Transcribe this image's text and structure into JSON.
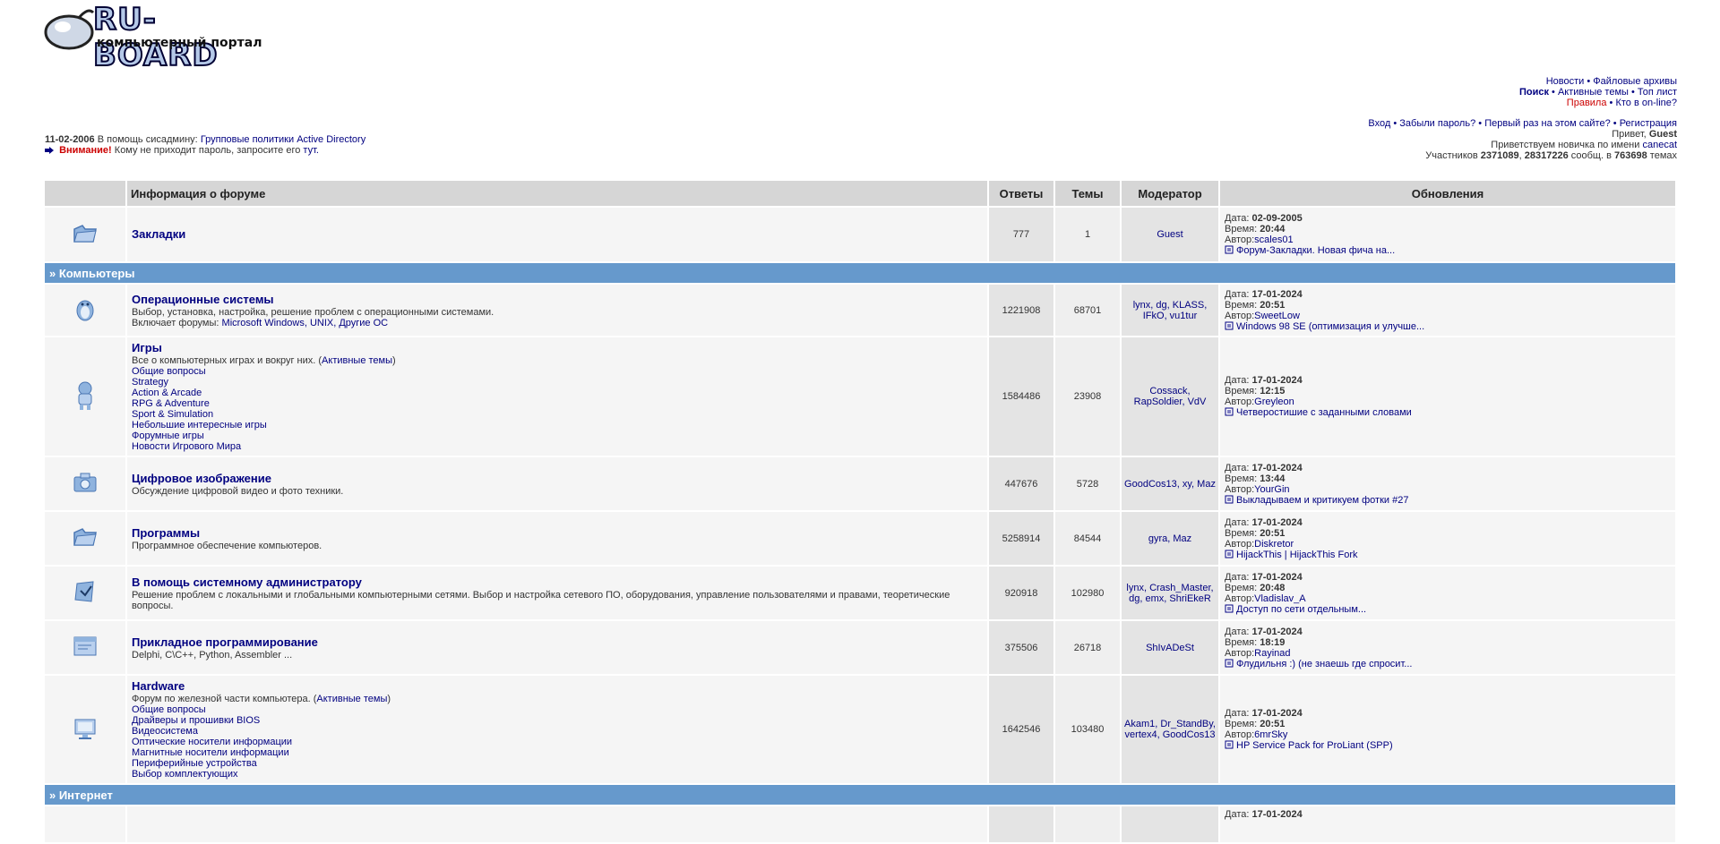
{
  "logo": {
    "name": "RU-BOARD",
    "subtitle": "компьютерный портал"
  },
  "nav": {
    "news": "Новости",
    "archives": "Файловые архивы",
    "search": "Поиск",
    "active": "Активные темы",
    "top": "Топ лист",
    "rules": "Правила",
    "online": "Кто в on-line?"
  },
  "auth": {
    "login": "Вход",
    "forgot": "Забыли пароль?",
    "first": "Первый раз на этом сайте?",
    "register": "Регистрация",
    "hello": "Привет,",
    "user": "Guest",
    "welcome": "Приветствуем новичка по имени",
    "newbie": "canecat",
    "stats_prefix": "Участников",
    "members": "2371089",
    "posts": "28317226",
    "posts_suffix": "сообщ. в",
    "topics": "763698",
    "topics_suffix": "темах"
  },
  "info": {
    "date": "11-02-2006",
    "help_prefix": "В помощь сисадмину:",
    "help_link": "Групповые политики Active Directory",
    "warn": "Внимание!",
    "warn_text": "Кому не приходит пароль, запросите его",
    "warn_link": "тут."
  },
  "table": {
    "headers": {
      "info": "Информация о форуме",
      "replies": "Ответы",
      "topics": "Темы",
      "moderator": "Модератор",
      "updates": "Обновления"
    },
    "labels": {
      "date": "Дата:",
      "time": "Время:",
      "author": "Автор:"
    },
    "bookmarks": {
      "title": "Закладки",
      "replies": "777",
      "topics": "1",
      "moderator": "Guest",
      "date": "02-09-2005",
      "time": "20:44",
      "author": "scales01",
      "last": "Форум-Закладки. Новая фича на..."
    },
    "categories": {
      "computers": "» Компьютеры",
      "internet": "» Интернет"
    },
    "forums": [
      {
        "title": "Операционные системы",
        "desc": "Выбор, установка, настройка, решение проблем с операционными системами.",
        "includes_prefix": "Включает форумы:",
        "includes": "Microsoft Windows, UNIX, Другие ОС",
        "replies": "1221908",
        "topics": "68701",
        "moderator": "lynx, dg, KLASS, IFkO, vu1tur",
        "date": "17-01-2024",
        "time": "20:51",
        "author": "SweetLow",
        "last": "Windows 98 SE (оптимизация и улучше..."
      },
      {
        "title": "Игры",
        "desc": "Все о компьютерных играх и вокруг них. (",
        "desc_link": "Активные темы",
        "desc_end": ")",
        "subs": [
          "Общие вопросы",
          "Strategy",
          "Action & Arcade",
          "RPG & Adventure",
          "Sport & Simulation",
          "Небольшие интересные игры",
          "Форумные игры",
          "Новости Игрового Мира"
        ],
        "replies": "1584486",
        "topics": "23908",
        "moderator": "Cossack, RapSoldier, VdV",
        "date": "17-01-2024",
        "time": "12:15",
        "author": "Greyleon",
        "last": "Четверостишие с заданными словами"
      },
      {
        "title": "Цифровое изображение",
        "desc": "Обсуждение цифровой видео и фото техники.",
        "replies": "447676",
        "topics": "5728",
        "moderator": "GoodCos13, xy, Maz",
        "date": "17-01-2024",
        "time": "13:44",
        "author": "YourGin",
        "last": "Выкладываем и критикуем фотки #27"
      },
      {
        "title": "Программы",
        "desc": "Программное обеспечение компьютеров.",
        "replies": "5258914",
        "topics": "84544",
        "moderator": "gyra, Maz",
        "date": "17-01-2024",
        "time": "20:51",
        "author": "Diskretor",
        "last": "HijackThis | HijackThis Fork"
      },
      {
        "title": "В помощь системному администратору",
        "desc": "Решение проблем с локальными и глобальными компьютерными сетями. Выбор и настройка сетевого ПО, оборудования, управление пользователями и правами, теоретические вопросы.",
        "replies": "920918",
        "topics": "102980",
        "moderator": "lynx, Crash_Master, dg, emx, ShriEkeR",
        "date": "17-01-2024",
        "time": "20:48",
        "author": "Vladislav_A",
        "last": "Доступ по сети отдельным..."
      },
      {
        "title": "Прикладное программирование",
        "desc": "Delphi, C\\C++, Python, Assembler ...",
        "replies": "375506",
        "topics": "26718",
        "moderator": "ShIvADeSt",
        "date": "17-01-2024",
        "time": "18:19",
        "author": "Rayinad",
        "last": "Флудильня :) (не знаешь где спросит..."
      },
      {
        "title": "Hardware",
        "desc": "Форум по железной части компьютера. (",
        "desc_link": "Активные темы",
        "desc_end": ")",
        "subs": [
          "Общие вопросы",
          "Драйверы и прошивки BIOS",
          "Видеосистема",
          "Оптические носители информации",
          "Магнитные носители информации",
          "Периферийные устройства",
          "Выбор комплектующих"
        ],
        "replies": "1642546",
        "topics": "103480",
        "moderator": "Akam1, Dr_StandBy, vertex4, GoodCos13",
        "date": "17-01-2024",
        "time": "20:51",
        "author": "6mrSky",
        "last": "HP Service Pack for ProLiant (SPP)"
      }
    ],
    "internet_first": {
      "date": "17-01-2024"
    }
  },
  "colors": {
    "link": "#000080",
    "category": "#6699cc",
    "header": "#d6d6d6",
    "warn": "#cc0000"
  },
  "icons": {
    "logo": "mouse-logo-icon",
    "forum": "forum-folder-icon",
    "last_post": "document-icon",
    "arrow": "arrow-right-icon"
  }
}
